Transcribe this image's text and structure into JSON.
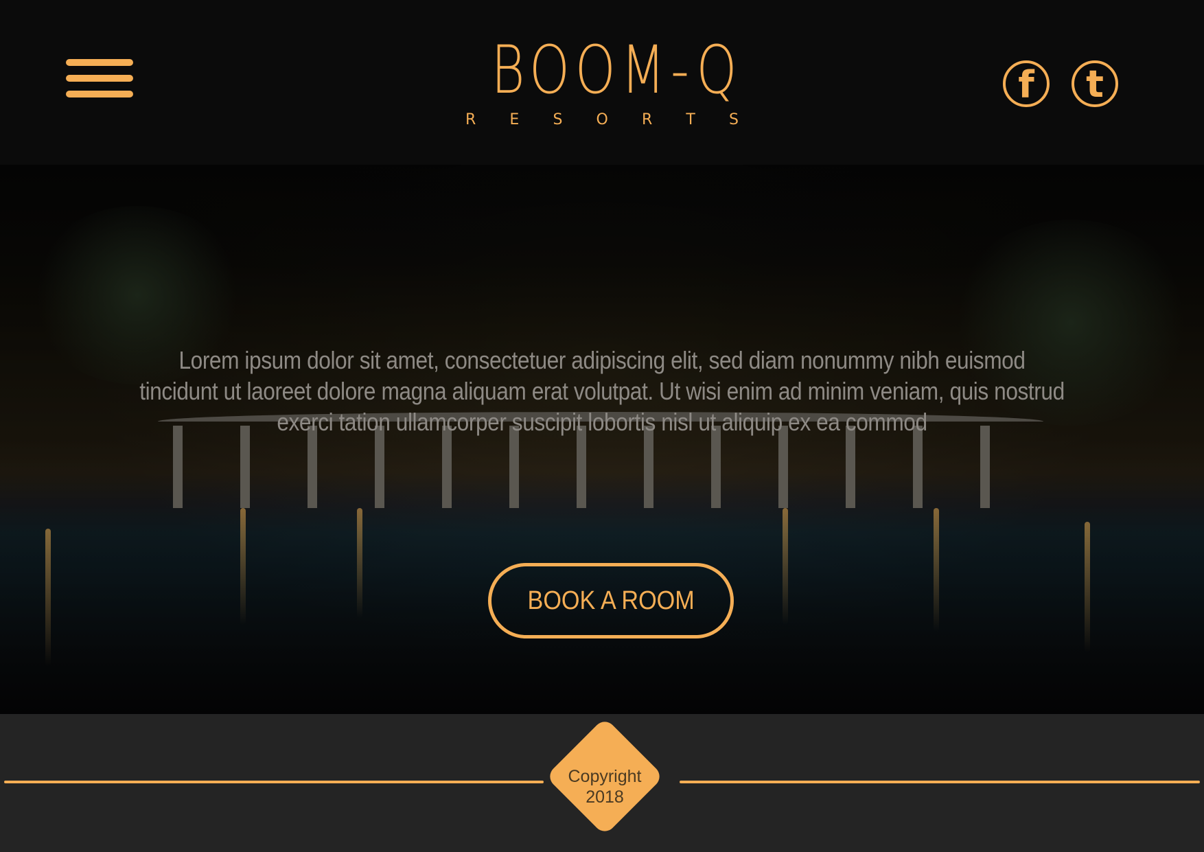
{
  "header": {
    "menu_icon": "hamburger-menu-icon",
    "logo": {
      "name": "BOOM-Q",
      "subtitle_letters": [
        "R",
        "E",
        "S",
        "O",
        "R",
        "T",
        "S"
      ]
    },
    "social": [
      {
        "name": "facebook",
        "glyph": "f",
        "icon": "facebook-icon"
      },
      {
        "name": "twitter",
        "glyph": "t",
        "icon": "twitter-icon"
      }
    ]
  },
  "hero": {
    "text": "Lorem ipsum dolor sit amet, consectetuer adipiscing elit, sed diam nonummy nibh euismod tincidunt ut laoreet dolore magna aliquam erat volutpat. Ut wisi enim ad minim veniam, quis nostrud exerci tation ullamcorper suscipit lobortis nisl ut aliquip ex ea commod",
    "cta_label": "BOOK A ROOM"
  },
  "footer": {
    "copyright_line1": "Copyright",
    "copyright_line2": "2018"
  },
  "colors": {
    "accent": "#f5ae55",
    "header_bg": "#0b0b0b",
    "footer_bg": "#242424",
    "hero_text": "#8e8a85"
  }
}
